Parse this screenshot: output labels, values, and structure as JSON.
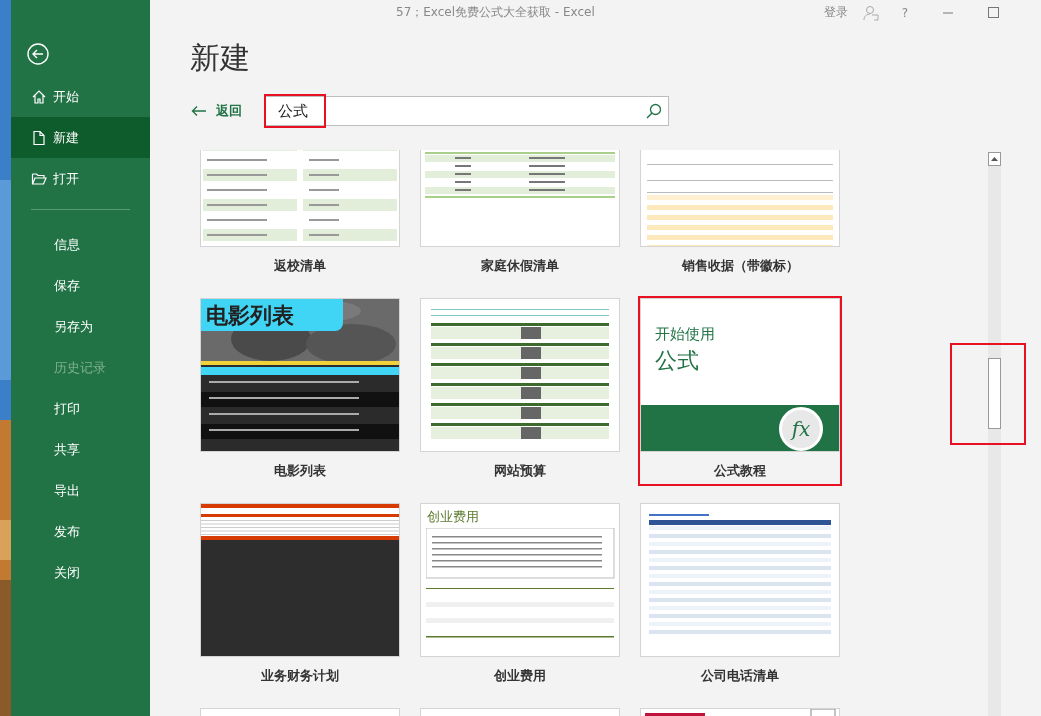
{
  "window": {
    "title": "57；Excel免费公式大全获取  -  Excel"
  },
  "title_bar": {
    "sign_in": "登录",
    "help": "?"
  },
  "sidebar": {
    "items": [
      {
        "label": "开始",
        "selected": false,
        "disabled": false
      },
      {
        "label": "新建",
        "selected": true,
        "disabled": false
      },
      {
        "label": "打开",
        "selected": false,
        "disabled": false
      },
      {
        "label": "信息",
        "selected": false,
        "disabled": false
      },
      {
        "label": "保存",
        "selected": false,
        "disabled": false
      },
      {
        "label": "另存为",
        "selected": false,
        "disabled": false
      },
      {
        "label": "历史记录",
        "selected": false,
        "disabled": true
      },
      {
        "label": "打印",
        "selected": false,
        "disabled": false
      },
      {
        "label": "共享",
        "selected": false,
        "disabled": false
      },
      {
        "label": "导出",
        "selected": false,
        "disabled": false
      },
      {
        "label": "发布",
        "selected": false,
        "disabled": false
      },
      {
        "label": "关闭",
        "selected": false,
        "disabled": false
      }
    ]
  },
  "page": {
    "heading": "新建",
    "back": "返回",
    "search": {
      "value": "公式",
      "highlighted": true
    }
  },
  "templates": [
    {
      "kind": "checklist",
      "name": "返校清单",
      "highlighted": false
    },
    {
      "kind": "vacation",
      "name": "家庭休假清单",
      "highlighted": false
    },
    {
      "kind": "receipt",
      "name": "销售收据（带徽标）",
      "highlighted": false
    },
    {
      "kind": "movies",
      "name": "电影列表",
      "thumb_title": "电影列表",
      "highlighted": false
    },
    {
      "kind": "budget",
      "name": "网站预算",
      "highlighted": false
    },
    {
      "kind": "formula",
      "name": "公式教程",
      "thumb_title": "开始使用",
      "thumb_subtitle": "公式",
      "thumb_icon": "fx",
      "highlighted": true
    },
    {
      "kind": "finance",
      "name": "业务财务计划",
      "highlighted": false
    },
    {
      "kind": "startup",
      "name": "创业费用",
      "thumb_title": "创业费用",
      "highlighted": false
    },
    {
      "kind": "phone",
      "name": "公司电话清单",
      "highlighted": false
    },
    {
      "kind": "blank",
      "highlighted": false
    },
    {
      "kind": "blank",
      "highlighted": false
    },
    {
      "kind": "sports",
      "highlighted": false
    }
  ],
  "scrollbar": {
    "highlighted": true
  }
}
